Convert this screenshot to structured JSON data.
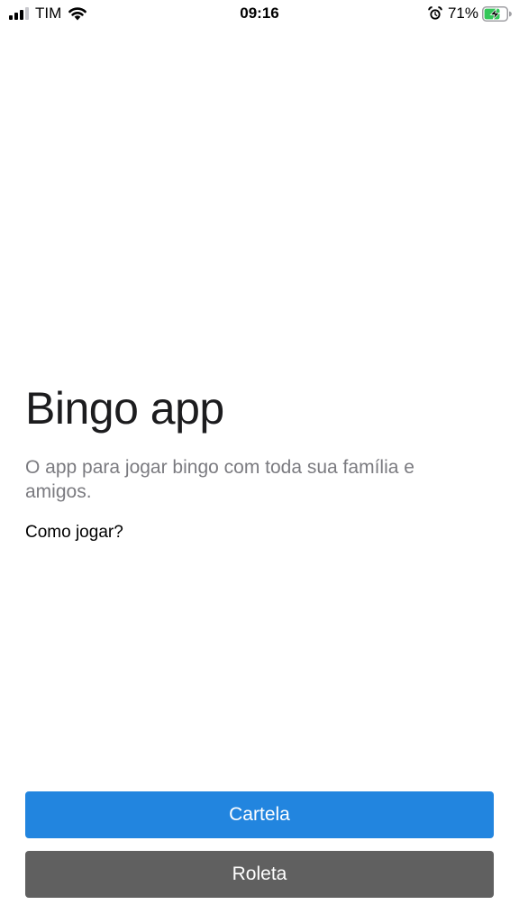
{
  "status_bar": {
    "carrier": "TIM",
    "time": "09:16",
    "battery_percent": "71%",
    "signal_icon": "signal-bars-icon",
    "wifi_icon": "wifi-icon",
    "alarm_icon": "alarm-clock-icon",
    "battery_icon": "battery-charging-icon",
    "battery_level": 0.71,
    "battery_color": "#34c759"
  },
  "main": {
    "title": "Bingo app",
    "subtitle": "O app para jogar bingo com toda sua família e amigos.",
    "how_to_link": "Como jogar?"
  },
  "buttons": {
    "cartela": {
      "label": "Cartela",
      "color": "#2285df"
    },
    "roleta": {
      "label": "Roleta",
      "color": "#606060"
    }
  }
}
